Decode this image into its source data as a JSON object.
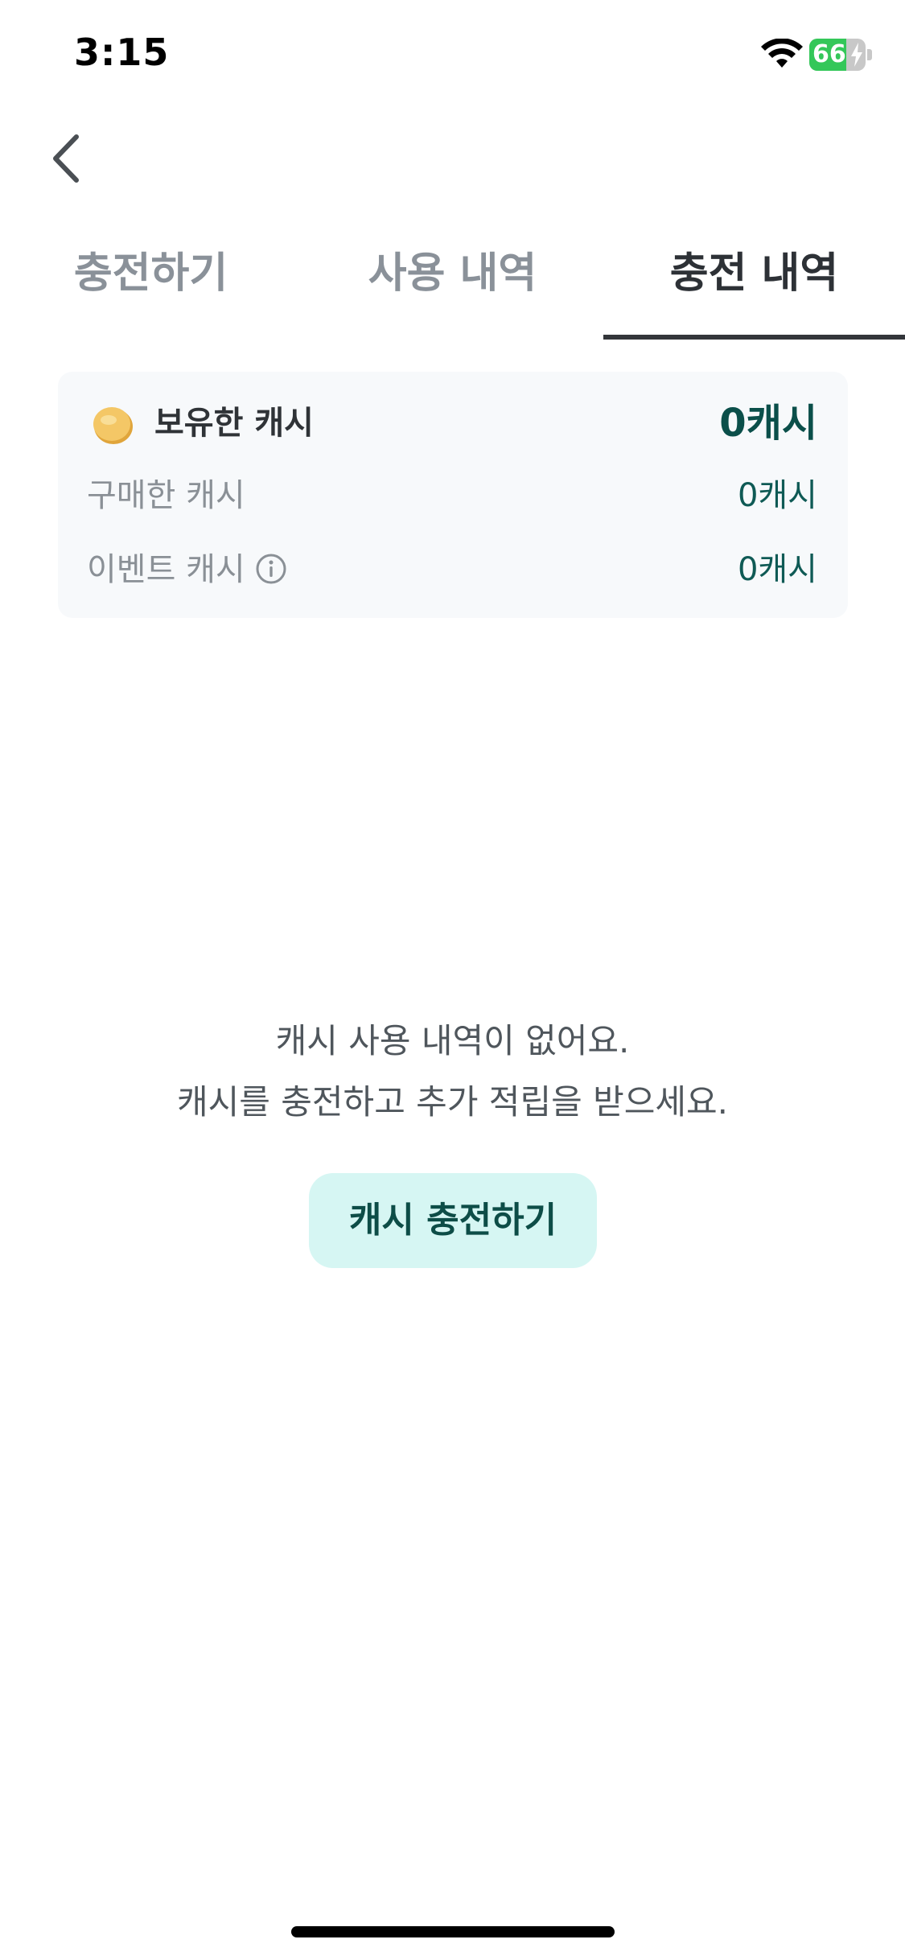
{
  "status_bar": {
    "time": "3:15",
    "battery_level": "66",
    "battery_fraction": 0.66,
    "wifi_icon": "wifi-icon",
    "charging_icon": "bolt-icon"
  },
  "nav": {
    "back_icon": "chevron-left-icon"
  },
  "tabs": [
    {
      "label": "충전하기",
      "active": false
    },
    {
      "label": "사용 내역",
      "active": false
    },
    {
      "label": "충전 내역",
      "active": true
    }
  ],
  "cash_summary": {
    "coin_icon": "coin-icon",
    "owned_label": "보유한 캐시",
    "owned_value": "0캐시",
    "purchased_label": "구매한 캐시",
    "purchased_value": "0캐시",
    "event_label": "이벤트 캐시",
    "event_value": "0캐시",
    "info_icon": "info-icon"
  },
  "empty_state": {
    "line1": "캐시 사용 내역이 없어요.",
    "line2": "캐시를 충전하고 추가 적립을 받으세요.",
    "button_label": "캐시 충전하기"
  },
  "colors": {
    "accent_dark_teal": "#0b4f4a",
    "button_bg": "#d6f6f3",
    "tab_active": "#2d3136",
    "tab_inactive": "#8a9199",
    "card_bg": "#f7f9fb",
    "battery_green": "#34c759"
  }
}
